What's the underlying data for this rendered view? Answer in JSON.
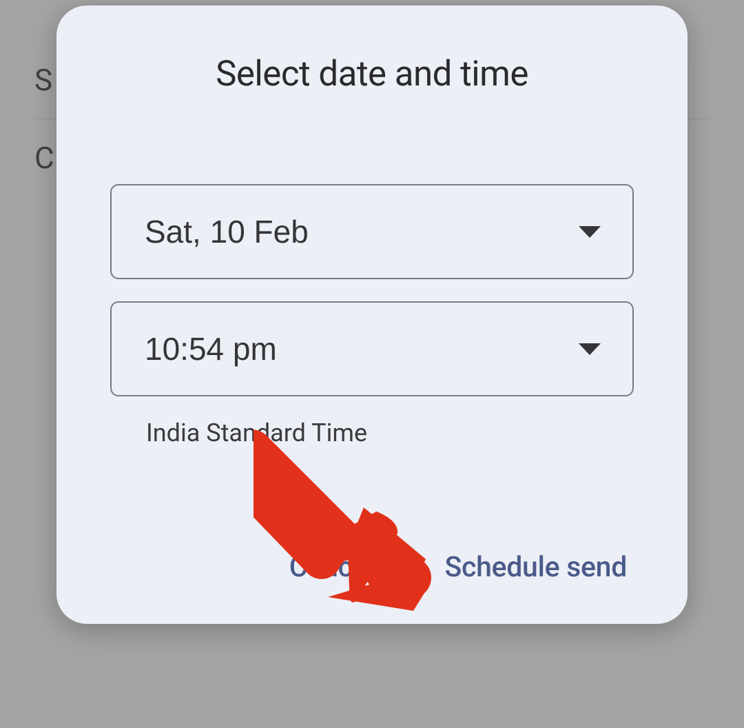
{
  "background": {
    "line1": "S",
    "line2": "C"
  },
  "dialog": {
    "title": "Select date and time",
    "date_field": {
      "value": "Sat, 10 Feb"
    },
    "time_field": {
      "value": "10:54 pm"
    },
    "timezone": "India Standard Time",
    "actions": {
      "cancel": "Cancel",
      "confirm": "Schedule send"
    }
  }
}
